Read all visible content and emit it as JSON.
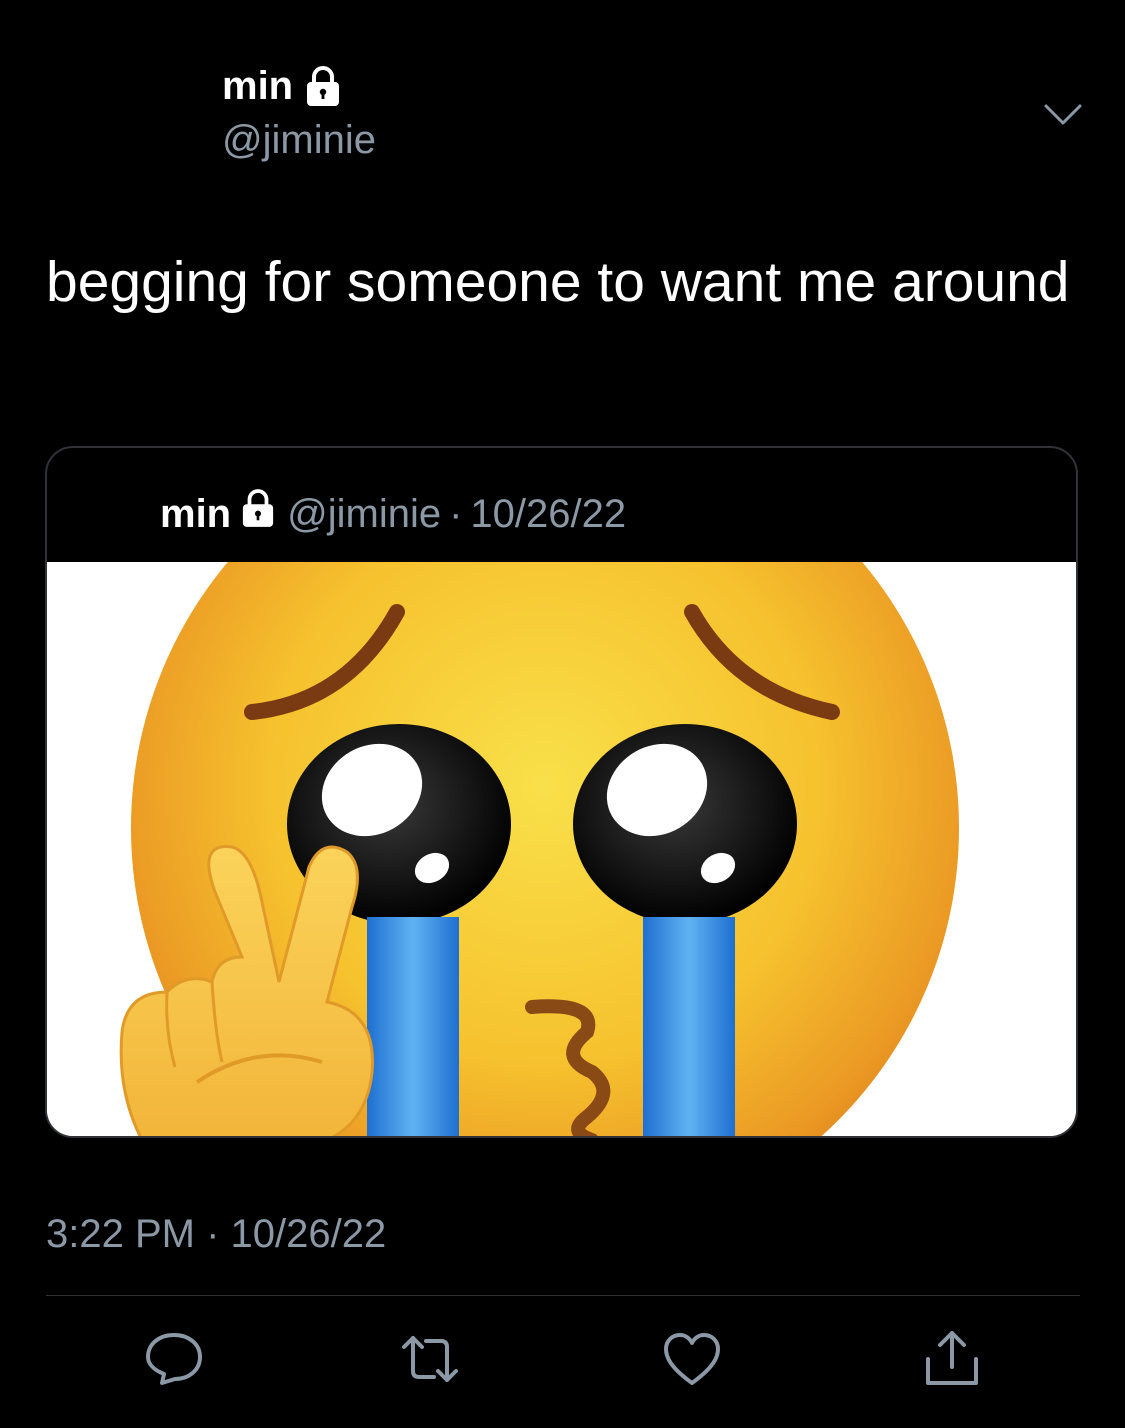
{
  "author": {
    "name": "min",
    "handle": "@jiminie",
    "lock_icon": "lock-icon"
  },
  "menu_icon": "chevron-down-icon",
  "tweet": {
    "text": "begging for someone to want me around"
  },
  "quoted_tweet": {
    "name": "min",
    "handle": "@jiminie",
    "separator": "·",
    "date": "10/26/22",
    "media": "pleading-face-crying-peace-sign-emoji-image"
  },
  "timestamp": {
    "time": "3:22 PM",
    "separator": "·",
    "date": "10/26/22"
  },
  "actions": {
    "reply": "reply-icon",
    "retweet": "retweet-icon",
    "like": "heart-icon",
    "share": "share-icon"
  },
  "colors": {
    "background": "#000000",
    "text_primary": "#ffffff",
    "text_secondary": "#8b98a5",
    "border": "#2f3336",
    "icon": "#8b98a5"
  }
}
